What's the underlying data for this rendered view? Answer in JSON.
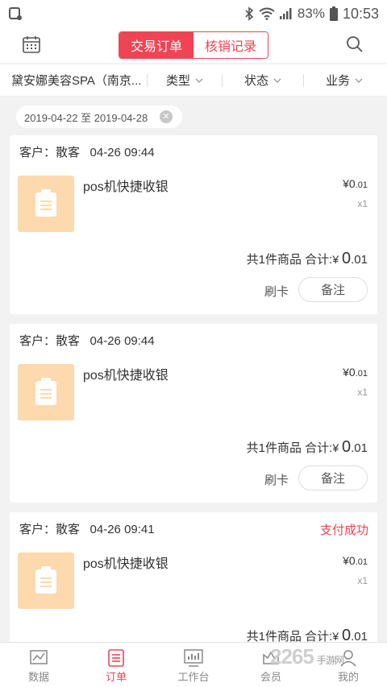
{
  "status_bar": {
    "battery": "83%",
    "time": "10:53"
  },
  "header": {
    "tabs": [
      {
        "label": "交易订单",
        "active": true
      },
      {
        "label": "核销记录",
        "active": false
      }
    ]
  },
  "filters": {
    "store": "黛安娜美容SPA（南京...",
    "type": "类型",
    "status": "状态",
    "business": "业务"
  },
  "date_range": "2019-04-22 至 2019-04-28",
  "orders": [
    {
      "customer": "客户：散客",
      "time": "04-26 09:44",
      "status": "",
      "product": "pos机快捷收银",
      "price_int": "¥0",
      "price_dec": ".01",
      "qty": "x1",
      "count_text": "共1件商品 合计:",
      "total_currency": "¥ ",
      "total_int": "0",
      "total_dec": ".01",
      "swipe_label": "刷卡",
      "note_label": "备注"
    },
    {
      "customer": "客户：散客",
      "time": "04-26 09:44",
      "status": "",
      "product": "pos机快捷收银",
      "price_int": "¥0",
      "price_dec": ".01",
      "qty": "x1",
      "count_text": "共1件商品 合计:",
      "total_currency": "¥ ",
      "total_int": "0",
      "total_dec": ".01",
      "swipe_label": "刷卡",
      "note_label": "备注"
    },
    {
      "customer": "客户：散客",
      "time": "04-26 09:41",
      "status": "支付成功",
      "product": "pos机快捷收银",
      "price_int": "¥0",
      "price_dec": ".01",
      "qty": "x1",
      "count_text": "共1件商品 合计:",
      "total_currency": "¥ ",
      "total_int": "0",
      "total_dec": ".01",
      "swipe_label": "",
      "note_label": ""
    }
  ],
  "bottom_nav": [
    {
      "label": "数据",
      "icon": "chart-icon",
      "active": false
    },
    {
      "label": "订单",
      "icon": "order-icon",
      "active": true
    },
    {
      "label": "工作台",
      "icon": "workbench-icon",
      "active": false
    },
    {
      "label": "会员",
      "icon": "member-icon",
      "active": false
    },
    {
      "label": "我的",
      "icon": "profile-icon",
      "active": false
    }
  ],
  "watermark": {
    "main": "2265",
    "sub": "手游网"
  },
  "colors": {
    "accent": "#f04455",
    "thumb": "#fdd9ad",
    "background": "#f2f2f2"
  }
}
